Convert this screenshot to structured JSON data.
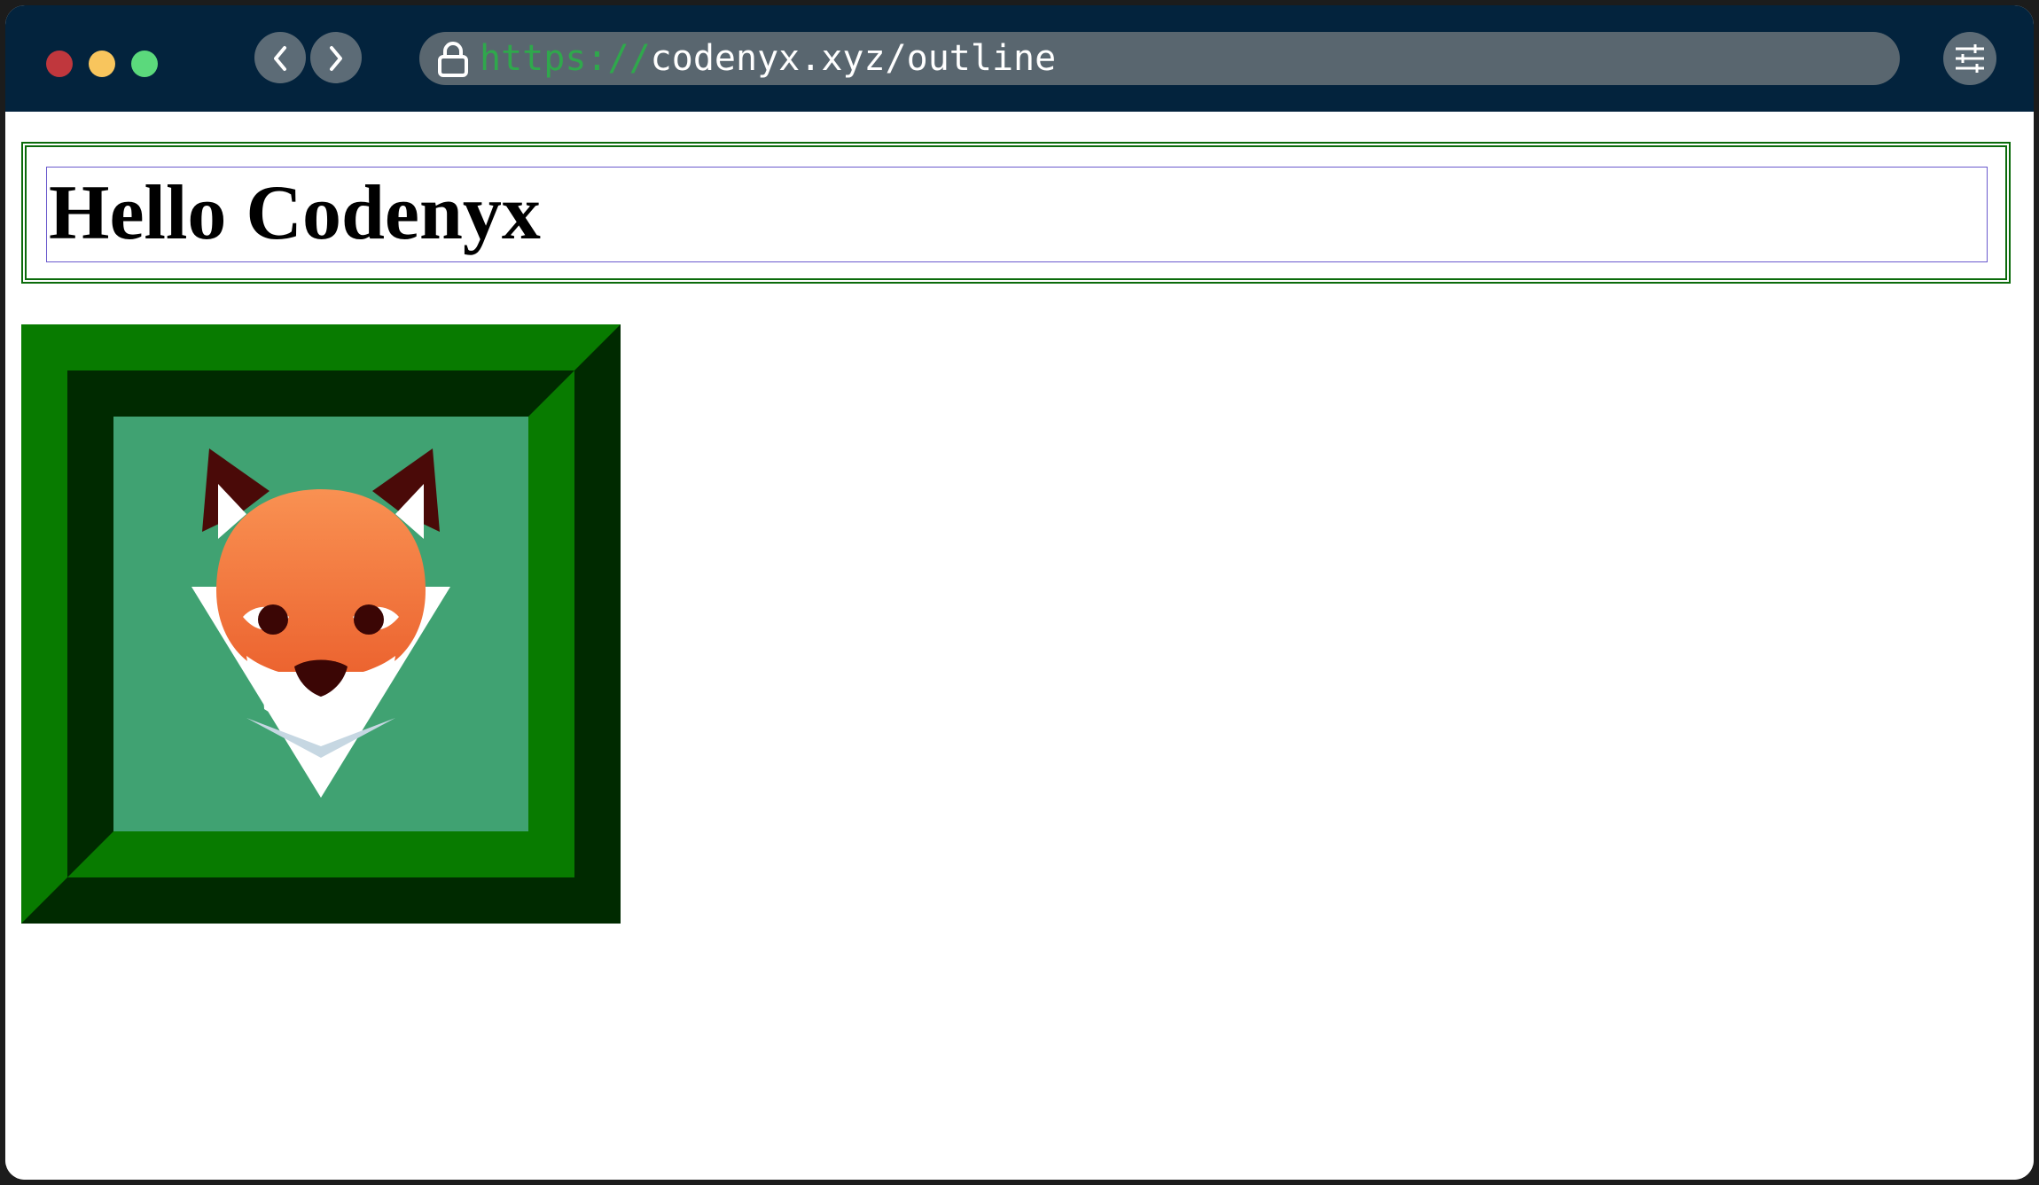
{
  "browser": {
    "url_scheme": "https://",
    "url_rest": "codenyx.xyz/outline",
    "colors": {
      "titlebar": "#03233d",
      "urlbar": "#59666f",
      "scheme": "#2fa84c",
      "close": "#c0373d",
      "minimize": "#f8c55d",
      "maximize": "#5bd97c"
    },
    "icons": {
      "back": "chevron-left-icon",
      "forward": "chevron-right-icon",
      "secure": "lock-icon",
      "settings": "sliders-icon"
    }
  },
  "page": {
    "heading": "Hello Codenyx",
    "colors": {
      "heading_border": "#0b6b0b",
      "heading_outline": "#6a5acd",
      "frame_light": "#087b00",
      "frame_dark": "#002a00",
      "image_bg": "#40a272"
    },
    "image_subject": "fox-logo"
  }
}
